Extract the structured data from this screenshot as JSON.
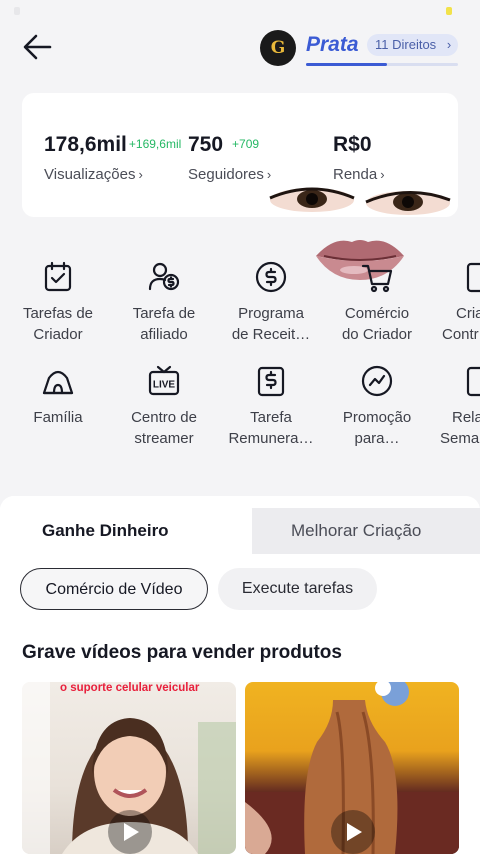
{
  "header": {
    "level_badge_letter": "G",
    "level_name": "Prata",
    "rights_label": "11 Direitos",
    "level_progress": 0.53
  },
  "stats": [
    {
      "value": "178,6mil",
      "delta": "+169,6mil",
      "label": "Visualizações"
    },
    {
      "value": "750",
      "delta": "+709",
      "label": "Seguidores"
    },
    {
      "value": "R$0",
      "delta": "",
      "label": "Renda"
    }
  ],
  "tools": [
    {
      "line1": "Tarefas de",
      "line2": "Criador",
      "icon": "calendar-check-icon"
    },
    {
      "line1": "Tarefa de",
      "line2": "afiliado",
      "icon": "people-dollar-icon"
    },
    {
      "line1": "Programa",
      "line2": "de Receit…",
      "icon": "dollar-coin-icon"
    },
    {
      "line1": "Comércio",
      "line2": "do Criador",
      "icon": "shopping-cart-icon"
    },
    {
      "line1": "Cria",
      "line2": "Contr",
      "icon": "document-icon"
    },
    {
      "line1": "Família",
      "line2": "",
      "icon": "tent-icon"
    },
    {
      "line1": "Centro de",
      "line2": "streamer",
      "icon": "live-tv-icon"
    },
    {
      "line1": "Tarefa",
      "line2": "Remunera…",
      "icon": "dollar-document-icon"
    },
    {
      "line1": "Promoção",
      "line2": "para…",
      "icon": "trend-icon"
    },
    {
      "line1": "Rela",
      "line2": "Sema",
      "icon": "report-icon"
    }
  ],
  "tabs": {
    "active": "Ganhe Dinheiro",
    "inactive": "Melhorar Criação"
  },
  "chips": {
    "selected": "Comércio de Vídeo",
    "other": "Execute tarefas"
  },
  "section_title": "Grave vídeos para vender produtos",
  "videos": [
    {
      "caption": "o suporte celular veicular",
      "icon": "play-icon"
    },
    {
      "caption": "",
      "icon": "play-icon"
    }
  ],
  "colors": {
    "accent_blue": "#3b5bd4",
    "delta_green": "#25b864",
    "caption_red": "#e8203c",
    "badge_gold": "#e9b93a"
  }
}
